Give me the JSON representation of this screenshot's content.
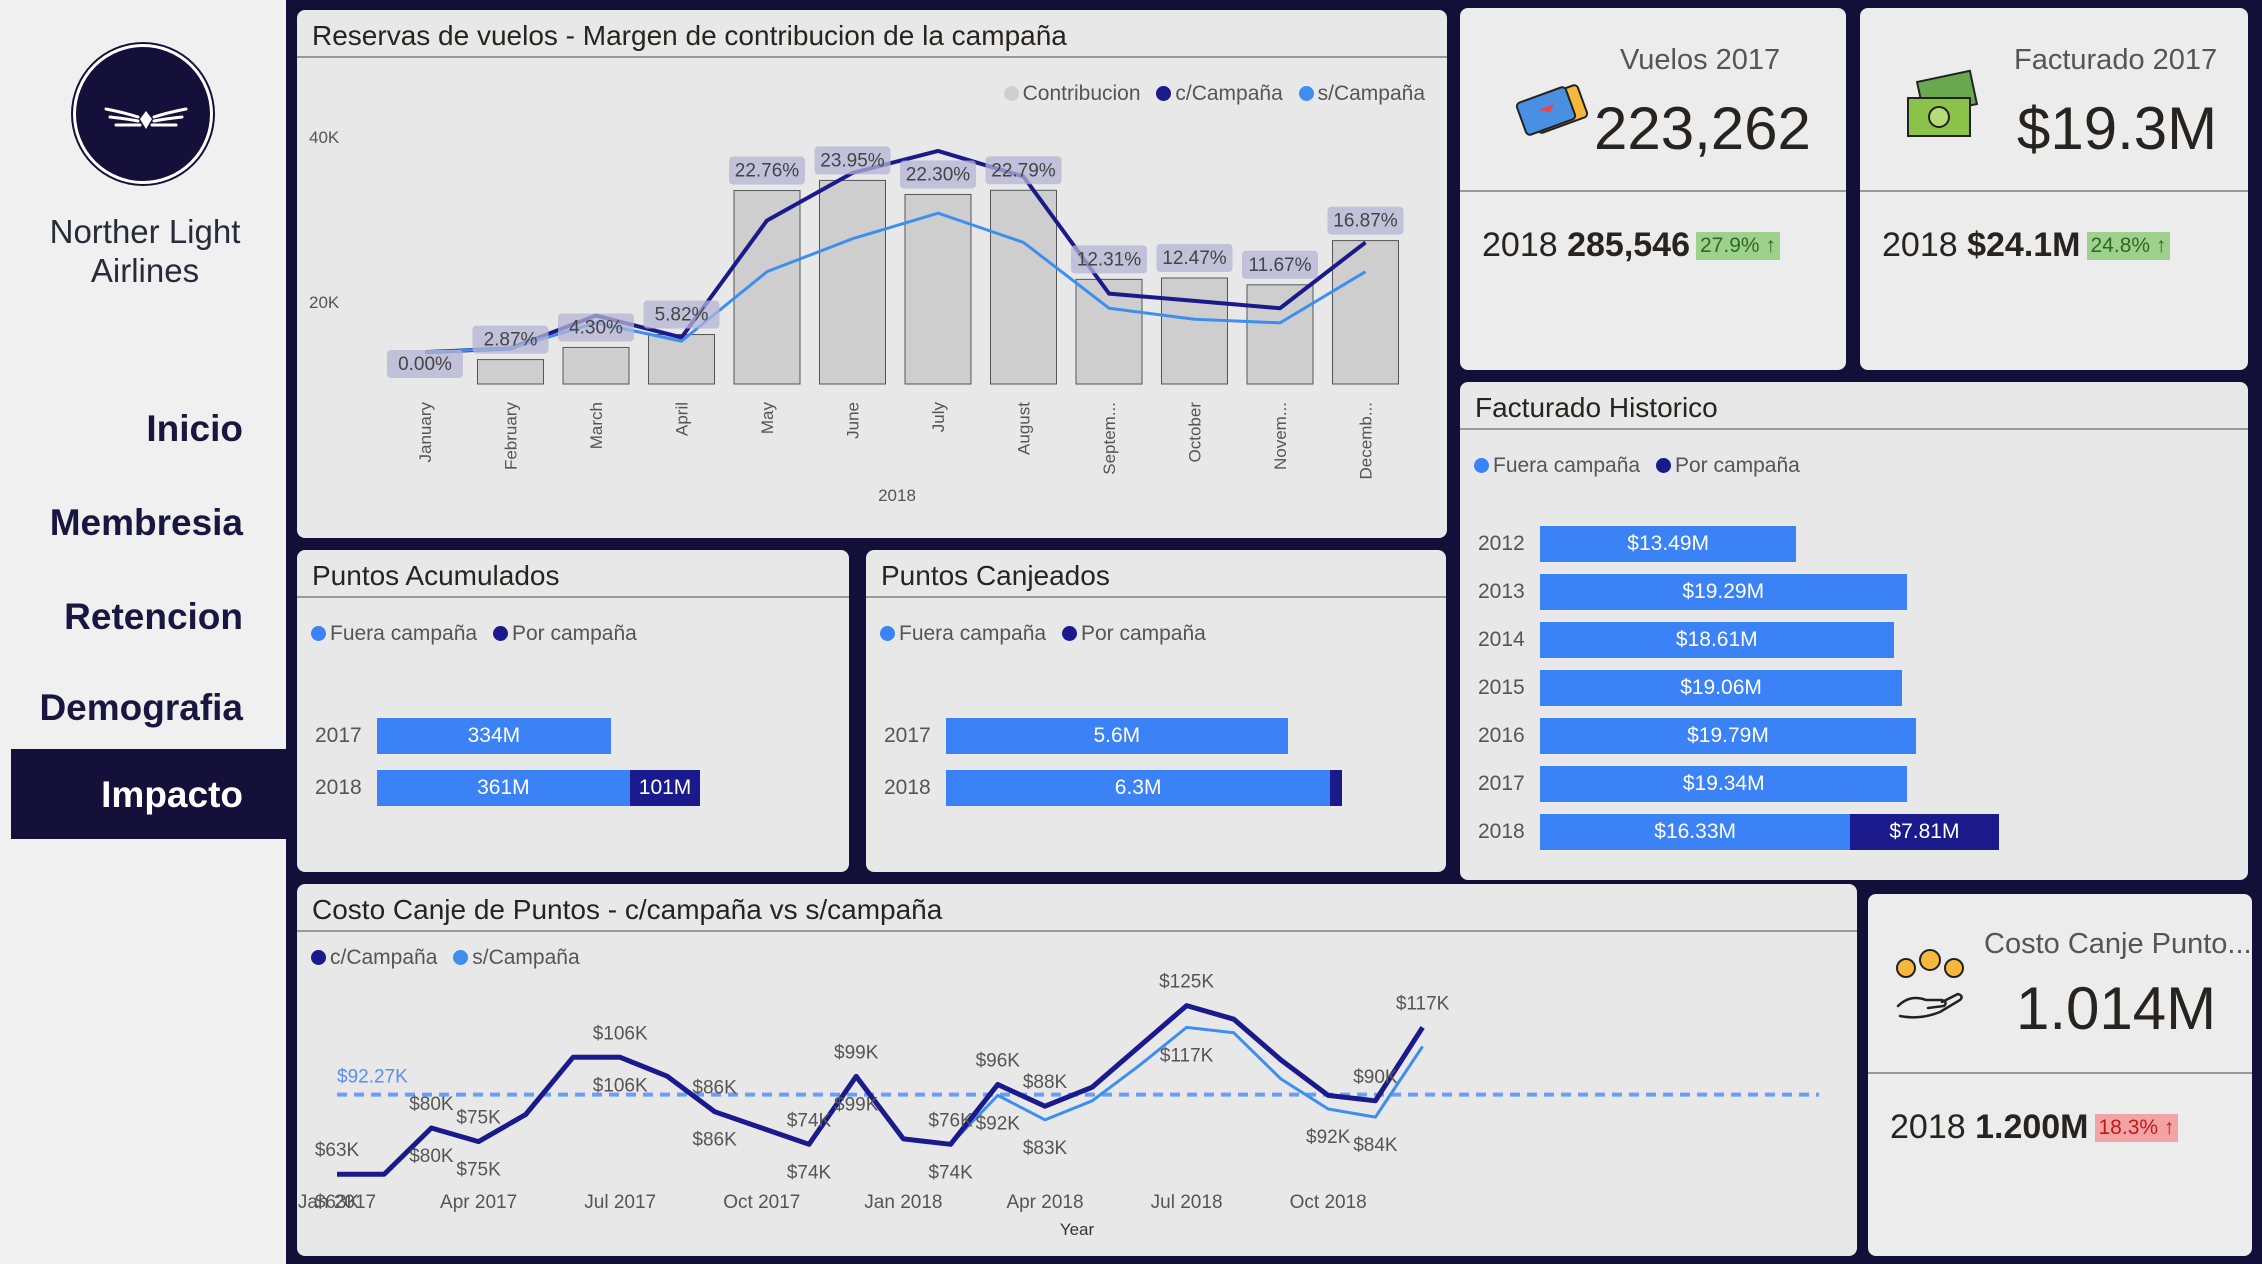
{
  "sidebar": {
    "brand_line1": "Norther Light",
    "brand_line2": "Airlines",
    "nav": [
      "Inicio",
      "Membresia",
      "Retencion",
      "Demografia",
      "Impacto"
    ],
    "active": "Impacto"
  },
  "colors": {
    "dark": "#1a1a8c",
    "light": "#3e8ef0",
    "bar": "#d0d0d0",
    "fuera": "#3b82f6",
    "por": "#1a1a8c"
  },
  "reservas": {
    "title": "Reservas de vuelos - Margen de contribucion de la campaña",
    "legend": [
      "Contribucion",
      "c/Campaña",
      "s/Campaña"
    ],
    "y_ticks": [
      "40K",
      "20K"
    ],
    "xlabel": "2018",
    "chart_data": {
      "type": "bar",
      "categories": [
        "January",
        "February",
        "March",
        "April",
        "May",
        "June",
        "July",
        "August",
        "Septem...",
        "October",
        "Novem...",
        "Decemb..."
      ],
      "bar_labels": [
        "0.00%",
        "2.87%",
        "4.30%",
        "5.82%",
        "22.76%",
        "23.95%",
        "22.30%",
        "22.79%",
        "12.31%",
        "12.47%",
        "11.67%",
        "16.87%"
      ],
      "series": [
        {
          "name": "Contribucion",
          "values": [
            0,
            2.87,
            4.3,
            5.82,
            22.76,
            23.95,
            22.3,
            22.79,
            12.31,
            12.47,
            11.67,
            16.87
          ]
        },
        {
          "name": "c/Campaña",
          "values": [
            16,
            16.5,
            21,
            18,
            34,
            40.5,
            43.5,
            40,
            24,
            23,
            22,
            31
          ]
        },
        {
          "name": "s/Campaña",
          "values": [
            16,
            16.5,
            20,
            17.5,
            27,
            31.5,
            35,
            31,
            22,
            20.5,
            20,
            27
          ]
        }
      ],
      "ylim": [
        10,
        45
      ]
    }
  },
  "vuelos": {
    "label": "Vuelos 2017",
    "value": "223,262",
    "year": "2018",
    "year_value": "285,546",
    "delta": "27.9%"
  },
  "facturado": {
    "label": "Facturado 2017",
    "value": "$19.3M",
    "year": "2018",
    "year_value": "$24.1M",
    "delta": "24.8%"
  },
  "historico": {
    "title": "Facturado Historico",
    "legend": [
      "Fuera campaña",
      "Por campaña"
    ],
    "chart_data": {
      "type": "bar",
      "categories": [
        "2012",
        "2013",
        "2014",
        "2015",
        "2016",
        "2017",
        "2018"
      ],
      "series": [
        {
          "name": "Fuera campaña",
          "values": [
            13.49,
            19.29,
            18.61,
            19.06,
            19.79,
            19.34,
            16.33
          ],
          "labels": [
            "$13.49M",
            "$19.29M",
            "$18.61M",
            "$19.06M",
            "$19.79M",
            "$19.34M",
            "$16.33M"
          ]
        },
        {
          "name": "Por campaña",
          "values": [
            0,
            0,
            0,
            0,
            0,
            0,
            7.81
          ],
          "labels": [
            "",
            "",
            "",
            "",
            "",
            "",
            "$7.81M"
          ]
        }
      ]
    }
  },
  "acumulados": {
    "title": "Puntos Acumulados",
    "legend": [
      "Fuera campaña",
      "Por campaña"
    ],
    "chart_data": {
      "type": "bar",
      "categories": [
        "2017",
        "2018"
      ],
      "series": [
        {
          "name": "Fuera campaña",
          "values": [
            334,
            361
          ],
          "labels": [
            "334M",
            "361M"
          ]
        },
        {
          "name": "Por campaña",
          "values": [
            0,
            101
          ],
          "labels": [
            "",
            "101M"
          ]
        }
      ]
    }
  },
  "canjeados": {
    "title": "Puntos Canjeados",
    "legend": [
      "Fuera campaña",
      "Por campaña"
    ],
    "chart_data": {
      "type": "bar",
      "categories": [
        "2017",
        "2018"
      ],
      "series": [
        {
          "name": "Fuera campaña",
          "values": [
            5.6,
            6.3
          ],
          "labels": [
            "5.6M",
            "6.3M"
          ]
        },
        {
          "name": "Por campaña",
          "values": [
            0,
            0.2
          ],
          "labels": [
            "",
            ""
          ]
        }
      ]
    }
  },
  "costo": {
    "title": "Costo Canje de Puntos - c/campaña vs s/campaña",
    "legend": [
      "c/Campaña",
      "s/Campaña"
    ],
    "avg_label": "$92.27K",
    "xlabel": "Year",
    "x_ticks": [
      "Jan 2017",
      "Apr 2017",
      "Jul 2017",
      "Oct 2017",
      "Jan 2018",
      "Apr 2018",
      "Jul 2018",
      "Oct 2018"
    ],
    "chart_data": {
      "type": "line",
      "series": [
        {
          "name": "c/Campaña",
          "values": [
            63,
            63,
            80,
            75,
            85,
            106,
            106,
            99,
            86,
            80,
            74,
            99,
            76,
            74,
            96,
            88,
            95,
            110,
            125,
            120,
            105,
            92,
            90,
            117
          ]
        },
        {
          "name": "s/Campaña",
          "values": [
            63,
            63,
            80,
            75,
            85,
            106,
            106,
            99,
            86,
            80,
            74,
            99,
            76,
            74,
            92,
            83,
            90,
            103,
            117,
            115,
            98,
            87,
            84,
            110
          ]
        }
      ],
      "average": 92.27,
      "point_labels": [
        {
          "i": 0,
          "t": "$63K",
          "s": 0
        },
        {
          "i": 0,
          "t": "$63K",
          "s": 1
        },
        {
          "i": 2,
          "t": "$80K",
          "s": 0
        },
        {
          "i": 2,
          "t": "$80K",
          "s": 1
        },
        {
          "i": 3,
          "t": "$75K",
          "s": 0
        },
        {
          "i": 3,
          "t": "$75K",
          "s": 1
        },
        {
          "i": 6,
          "t": "$106K",
          "s": 0
        },
        {
          "i": 6,
          "t": "$106K",
          "s": 1
        },
        {
          "i": 8,
          "t": "$86K",
          "s": 0
        },
        {
          "i": 8,
          "t": "$86K",
          "s": 1
        },
        {
          "i": 10,
          "t": "$74K",
          "s": 0
        },
        {
          "i": 10,
          "t": "$74K",
          "s": 1
        },
        {
          "i": 11,
          "t": "$99K",
          "s": 0
        },
        {
          "i": 11,
          "t": "$99K",
          "s": 1
        },
        {
          "i": 13,
          "t": "$76K",
          "s": 0
        },
        {
          "i": 13,
          "t": "$74K",
          "s": 1
        },
        {
          "i": 14,
          "t": "$96K",
          "s": 0
        },
        {
          "i": 14,
          "t": "$92K",
          "s": 1
        },
        {
          "i": 15,
          "t": "$88K",
          "s": 0
        },
        {
          "i": 15,
          "t": "$83K",
          "s": 1
        },
        {
          "i": 18,
          "t": "$125K",
          "s": 0
        },
        {
          "i": 18,
          "t": "$117K",
          "s": 1
        },
        {
          "i": 21,
          "t": "$92K",
          "s": 1
        },
        {
          "i": 22,
          "t": "$90K",
          "s": 0
        },
        {
          "i": 22,
          "t": "$84K",
          "s": 1
        },
        {
          "i": 23,
          "t": "$117K",
          "s": 0
        }
      ]
    }
  },
  "costo_kpi": {
    "label": "Costo Canje Punto...",
    "value": "1.014M",
    "year": "2018",
    "year_value": "1.200M",
    "delta": "18.3%"
  }
}
